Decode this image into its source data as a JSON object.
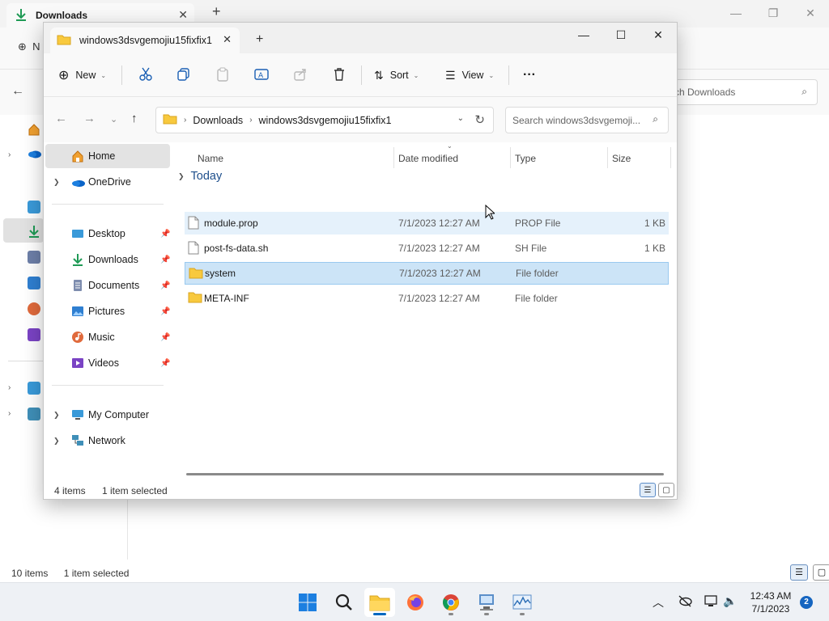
{
  "background_window": {
    "tab_title": "Downloads",
    "new_label": "N",
    "search_placeholder": "rch Downloads",
    "status": {
      "items": "10 items",
      "selected": "1 item selected"
    }
  },
  "window": {
    "tab_title": "windows3dsvgemojiu15fixfix1",
    "toolbar": {
      "new_label": "New",
      "sort_label": "Sort",
      "view_label": "View",
      "more_label": "···"
    },
    "address": {
      "segments": [
        "Downloads",
        "windows3dsvgemojiu15fixfix1"
      ]
    },
    "search": {
      "placeholder": "Search windows3dsvgemoji..."
    },
    "sidebar": {
      "items": [
        {
          "label": "Home",
          "icon": "home-icon",
          "active": true
        },
        {
          "label": "OneDrive",
          "icon": "onedrive-icon"
        },
        {
          "label": "Desktop",
          "icon": "desktop-icon",
          "pinned": true
        },
        {
          "label": "Downloads",
          "icon": "downloads-icon",
          "pinned": true
        },
        {
          "label": "Documents",
          "icon": "documents-icon",
          "pinned": true
        },
        {
          "label": "Pictures",
          "icon": "pictures-icon",
          "pinned": true
        },
        {
          "label": "Music",
          "icon": "music-icon",
          "pinned": true
        },
        {
          "label": "Videos",
          "icon": "videos-icon",
          "pinned": true
        },
        {
          "label": "My Computer",
          "icon": "computer-icon"
        },
        {
          "label": "Network",
          "icon": "network-icon"
        }
      ]
    },
    "columns": [
      "Name",
      "Date modified",
      "Type",
      "Size"
    ],
    "group_label": "Today",
    "files": [
      {
        "name": "module.prop",
        "date": "7/1/2023 12:27 AM",
        "type": "PROP File",
        "size": "1 KB",
        "icon": "file-icon",
        "state": "hover"
      },
      {
        "name": "post-fs-data.sh",
        "date": "7/1/2023 12:27 AM",
        "type": "SH File",
        "size": "1 KB",
        "icon": "file-icon",
        "state": ""
      },
      {
        "name": "system",
        "date": "7/1/2023 12:27 AM",
        "type": "File folder",
        "size": "",
        "icon": "folder-icon",
        "state": "selected"
      },
      {
        "name": "META-INF",
        "date": "7/1/2023 12:27 AM",
        "type": "File folder",
        "size": "",
        "icon": "folder-icon",
        "state": ""
      }
    ],
    "status": {
      "items": "4 items",
      "selected": "1 item selected"
    }
  },
  "taskbar": {
    "apps": [
      "start-icon",
      "search-icon",
      "file-explorer-icon",
      "firefox-icon",
      "chrome-icon",
      "remote-desktop-icon",
      "task-manager-icon"
    ],
    "clock": {
      "time": "12:43 AM",
      "date": "7/1/2023"
    },
    "notification_count": "2"
  },
  "colors": {
    "accent": "#0067c0",
    "selection": "#cce4f7",
    "hover": "#e5f1fb",
    "folder": "#f8c93e",
    "group_header": "#1e4f8c"
  }
}
